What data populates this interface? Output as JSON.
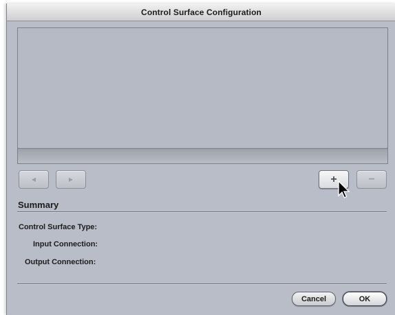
{
  "window": {
    "title": "Control Surface Configuration"
  },
  "nav_buttons": {
    "back_icon": "left-triangle-icon",
    "forward_icon": "right-triangle-icon"
  },
  "list_buttons": {
    "add_label": "+",
    "remove_label": "−"
  },
  "summary": {
    "title": "Summary",
    "fields": [
      {
        "label": "Control Surface Type:"
      },
      {
        "label": "Input Connection:"
      },
      {
        "label": "Output Connection:"
      }
    ]
  },
  "footer": {
    "cancel_label": "Cancel",
    "ok_label": "OK"
  },
  "colors": {
    "window_bg": "#b9bdc7",
    "list_bg": "#b6bac4"
  }
}
